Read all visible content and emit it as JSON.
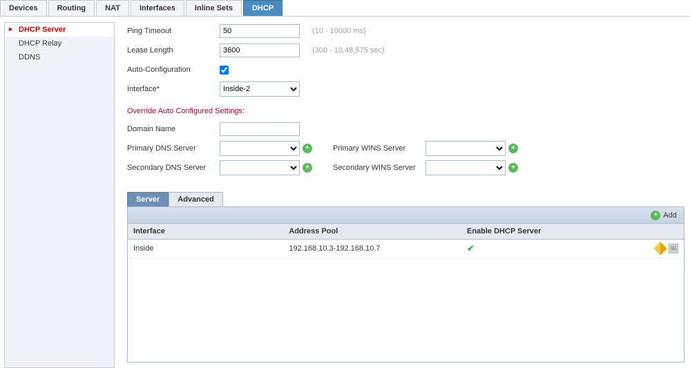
{
  "top_tabs": {
    "devices": "Devices",
    "routing": "Routing",
    "nat": "NAT",
    "interfaces": "Interfaces",
    "inline_sets": "Inline Sets",
    "dhcp": "DHCP"
  },
  "side_nav": {
    "dhcp_server": "DHCP Server",
    "dhcp_relay": "DHCP Relay",
    "ddns": "DDNS"
  },
  "form": {
    "ping_timeout_label": "Ping Timeout",
    "ping_timeout_value": "50",
    "ping_timeout_hint": "(10 - 10000 ms)",
    "lease_length_label": "Lease Length",
    "lease_length_value": "3600",
    "lease_length_hint": "(300 - 10,48,575 sec)",
    "auto_config_label": "Auto-Configuration",
    "auto_config_checked": true,
    "interface_label": "Interface*",
    "interface_value": "Inside-2",
    "override_title": "Override Auto Configured Settings:",
    "domain_name_label": "Domain Name",
    "domain_name_value": "",
    "primary_dns_label": "Primary DNS Server",
    "secondary_dns_label": "Secondary DNS Server",
    "primary_wins_label": "Primary WINS Server",
    "secondary_wins_label": "Secondary WINS Server"
  },
  "lower_tabs": {
    "server": "Server",
    "advanced": "Advanced"
  },
  "toolbar": {
    "add_label": "Add"
  },
  "table": {
    "col_interface": "Interface",
    "col_address_pool": "Address Pool",
    "col_enable": "Enable DHCP Server",
    "rows": [
      {
        "interface": "Inside",
        "address_pool": "192.168.10.3-192.168.10.7",
        "enabled": true
      }
    ]
  }
}
